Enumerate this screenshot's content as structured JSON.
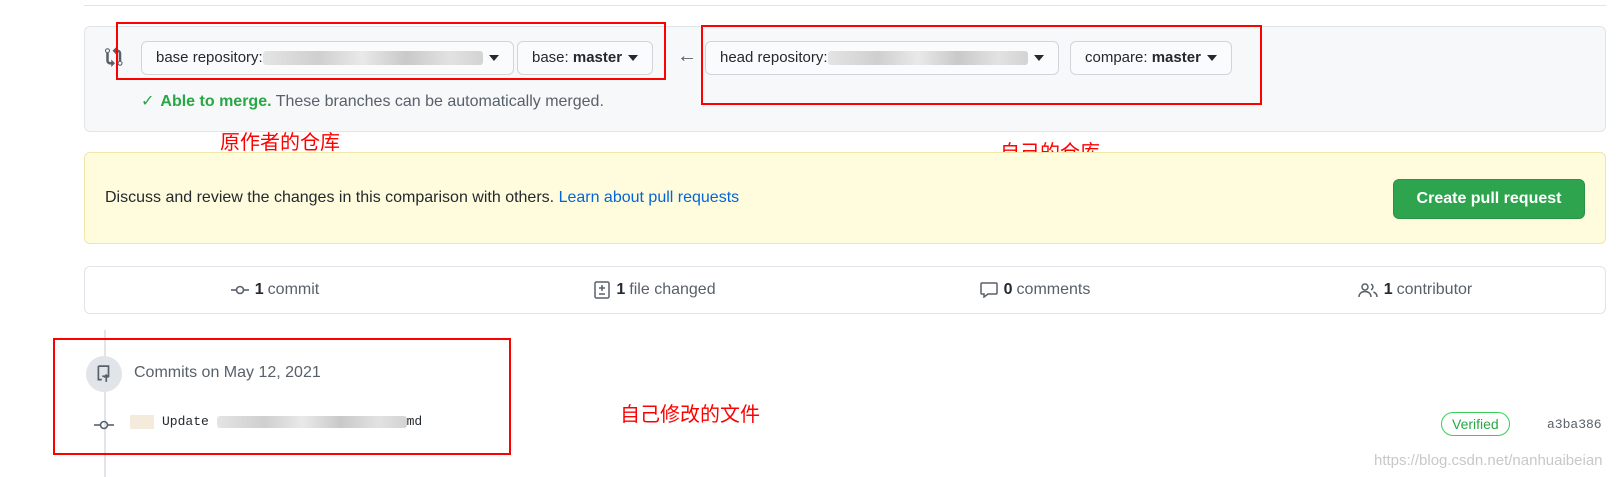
{
  "range": {
    "base_repo_label": "base repository:",
    "base_branch_prefix": "base:",
    "base_branch": "master",
    "head_repo_label": "head repository:",
    "compare_prefix": "compare:",
    "compare_branch": "master",
    "merge_ok": "Able to merge.",
    "merge_rest": "These branches can be automatically merged."
  },
  "annotations": {
    "base": "原作者的仓库",
    "head": "自己的仓库",
    "commit": "自己修改的文件"
  },
  "flash": {
    "text": "Discuss and review the changes in this comparison with others.",
    "link": "Learn about pull requests",
    "button": "Create pull request"
  },
  "summary": {
    "commits_count": "1",
    "commits_label": "commit",
    "files_count": "1",
    "files_label": "file changed",
    "comments_count": "0",
    "comments_label": "comments",
    "contributors_count": "1",
    "contributors_label": "contributor"
  },
  "commits": {
    "group_title": "Commits on May 12, 2021",
    "message_prefix": "Update",
    "message_suffix": "md",
    "verified": "Verified",
    "sha": "a3ba386"
  },
  "watermark": "https://blog.csdn.net/nanhuaibeian",
  "colors": {
    "accent_green": "#2ea44f",
    "link_blue": "#0366d6",
    "annotation_red": "#ff0000"
  }
}
